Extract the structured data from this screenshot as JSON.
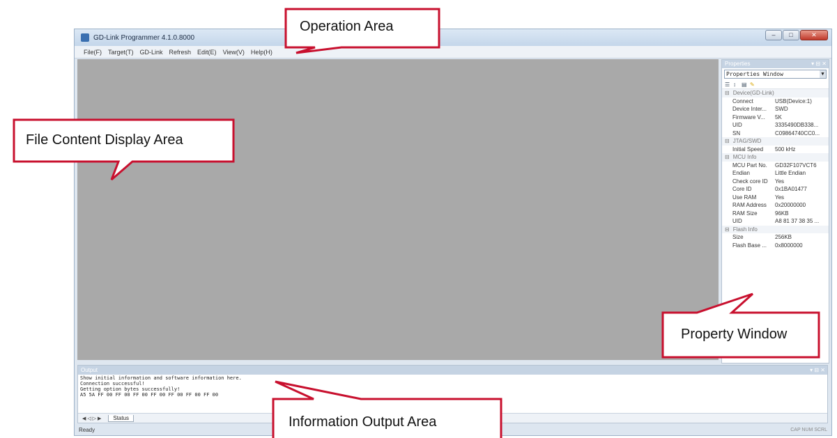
{
  "window": {
    "title": "GD-Link Programmer 4.1.0.8000",
    "controls": [
      "–",
      "□",
      "✕"
    ]
  },
  "menu": [
    "File(F)",
    "Target(T)",
    "GD-Link",
    "Refresh",
    "Edit(E)",
    "View(V)",
    "Help(H)"
  ],
  "properties": {
    "header": "Properties",
    "header_buttons": "▾ ⊟ ✕",
    "selector": "Properties Window",
    "toolbar_icons": [
      "categorized-icon",
      "sort-icon",
      "property-pages-icon",
      "pencil-icon"
    ],
    "categories": [
      {
        "label": "Device(GD-Link)",
        "rows": [
          {
            "key": "Connect",
            "value": "USB(Device:1)"
          },
          {
            "key": "Device Inter...",
            "value": "SWD"
          },
          {
            "key": "Firmware V...",
            "value": "5K"
          },
          {
            "key": "UID",
            "value": "3335490DB338..."
          },
          {
            "key": "SN",
            "value": "C09864740CC0..."
          }
        ]
      },
      {
        "label": "JTAG/SWD",
        "rows": [
          {
            "key": "Initial Speed",
            "value": "500 kHz"
          }
        ]
      },
      {
        "label": "MCU Info",
        "rows": [
          {
            "key": "MCU Part No.",
            "value": "GD32F107VCT6"
          },
          {
            "key": "Endian",
            "value": "Little Endian"
          },
          {
            "key": "Check core ID",
            "value": "Yes"
          },
          {
            "key": "Core ID",
            "value": "0x1BA01477"
          },
          {
            "key": "Use RAM",
            "value": "Yes"
          },
          {
            "key": "RAM Address",
            "value": "0x20000000"
          },
          {
            "key": "RAM Size",
            "value": "96KB"
          },
          {
            "key": "UID",
            "value": "A8 81 37 38 35 ..."
          }
        ]
      },
      {
        "label": "Flash Info",
        "rows": [
          {
            "key": "Size",
            "value": "256KB"
          },
          {
            "key": "Flash Base ...",
            "value": "0x8000000"
          }
        ]
      }
    ]
  },
  "output": {
    "header": "Output",
    "lines": [
      "Show initial information and software information here.",
      "Connection successful!",
      "Getting option bytes successfully!",
      "A5 5A FF 00 FF 00 FF 00 FF 00 FF 00 FF 00 FF 00"
    ],
    "nav_arrows": "◀ ◁ ▷ ▶",
    "tab_label": "Status"
  },
  "statusbar": {
    "text": "Ready",
    "indicators": "CAP NUM SCRL"
  },
  "callouts": {
    "operation_area": "Operation Area",
    "file_content": "File Content Display Area",
    "property_window": "Property Window",
    "information_output": "Information Output Area"
  },
  "colors": {
    "callout_border": "#c8102e",
    "content_area": "#a9a9a9",
    "panel_header": "#c5d3e3"
  }
}
